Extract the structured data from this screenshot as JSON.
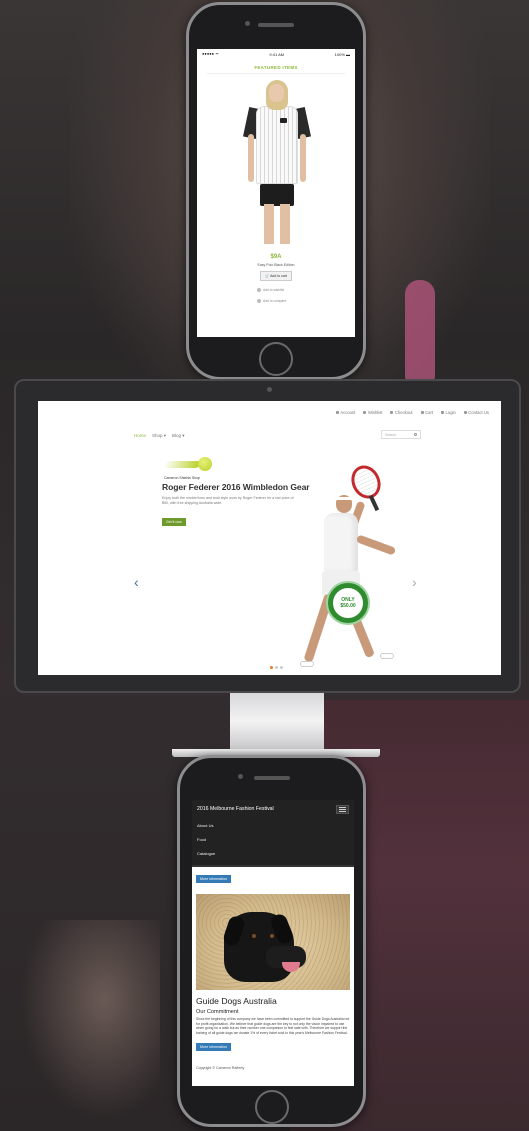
{
  "phone1": {
    "status": {
      "carrier": "●●●●● ᯤ",
      "time": "9:41 AM",
      "battery": "100% ▬"
    },
    "section_title": "FEATURED ITEMS",
    "product": {
      "price": "$9A",
      "name": "Easy Polo Black Edition",
      "add_to_cart": "🛒 Add to cart"
    },
    "links": {
      "wishlist": "Add to wishlist",
      "compare": "Add to compare"
    }
  },
  "desktop": {
    "topbar": [
      "Account",
      "Wishlist",
      "Checkout",
      "Cart",
      "Login",
      "Contact Us"
    ],
    "nav": {
      "home": "Home",
      "shop": "Shop ▾",
      "blog": "Blog ▾"
    },
    "search_placeholder": "Search",
    "hero": {
      "brand": "Cameron Shields Shop",
      "title": "Roger Federer 2016 Wimbledon Gear",
      "description": "Enjoy both the nimble lines and bold style worn by Roger Federer for a low price of $50, with free shipping Australia wide.",
      "button": "Get it now",
      "badge_line1": "ONLY",
      "badge_line2": "$50.00"
    },
    "arrows": {
      "prev": "‹",
      "next": "›"
    },
    "slides": {
      "count": 3,
      "active": 1
    }
  },
  "phone2": {
    "header_title": "2016 Melbourne Fashion Festival",
    "menu": [
      "About Us",
      "Food",
      "Catalogue"
    ],
    "more_info_top": "More information",
    "article": {
      "title": "Guide Dogs Australia",
      "subtitle": "Our Commitment",
      "body": "Since the beginning of this company we have been committed to support the Guide Dogs Australia not for profit organisation. We believe that guide dogs are the key to not only the vision impaired to use when going for a walk but as their number one companion to feel safe with. Therefore we support the training of all guide dogs we donate 1% of every ticket sold to this year's Melbourne Fashion Festival.",
      "more_info": "More information"
    },
    "copyright": "Copyright © Cameron Rafferty"
  }
}
